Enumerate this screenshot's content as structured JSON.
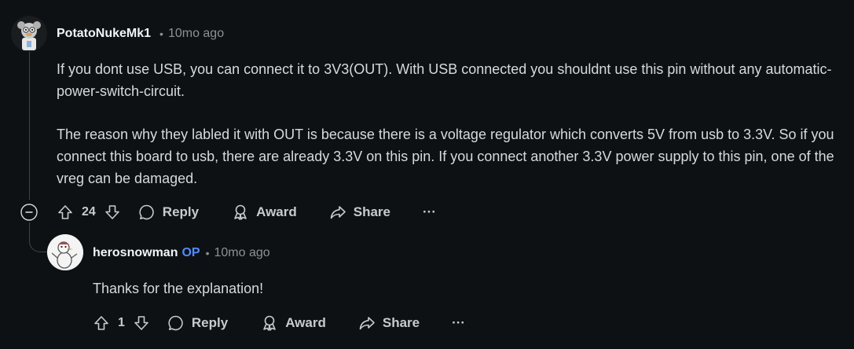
{
  "comment": {
    "author": "PotatoNukeMk1",
    "separator": "•",
    "time": "10mo ago",
    "paragraphs": [
      "If you dont use USB, you can connect it to 3V3(OUT). With USB connected you shouldnt use this pin without any automatic-power-switch-circuit.",
      "The reason why they labled it with OUT is because there is a voltage regulator which converts 5V from usb to 3.3V. So if you connect this board to usb, there are already 3.3V on this pin. If you connect another 3.3V power supply to this pin, one of the vreg can be damaged."
    ],
    "votes": "24",
    "reply_label": "Reply",
    "award_label": "Award",
    "share_label": "Share",
    "more_label": "···"
  },
  "reply": {
    "author": "herosnowman",
    "badge": "OP",
    "separator": "•",
    "time": "10mo ago",
    "text": "Thanks for the explanation!",
    "votes": "1",
    "reply_label": "Reply",
    "award_label": "Award",
    "share_label": "Share",
    "more_label": "···"
  },
  "icons": {
    "upvote": "upvote-icon",
    "downvote": "downvote-icon",
    "reply": "comment-bubble-icon",
    "award": "award-ribbon-icon",
    "share": "share-arrow-icon",
    "collapse": "collapse-minus-icon"
  },
  "colors": {
    "background": "#0e1113",
    "op_badge": "#4f8cff",
    "meta_text": "#8c9195"
  }
}
